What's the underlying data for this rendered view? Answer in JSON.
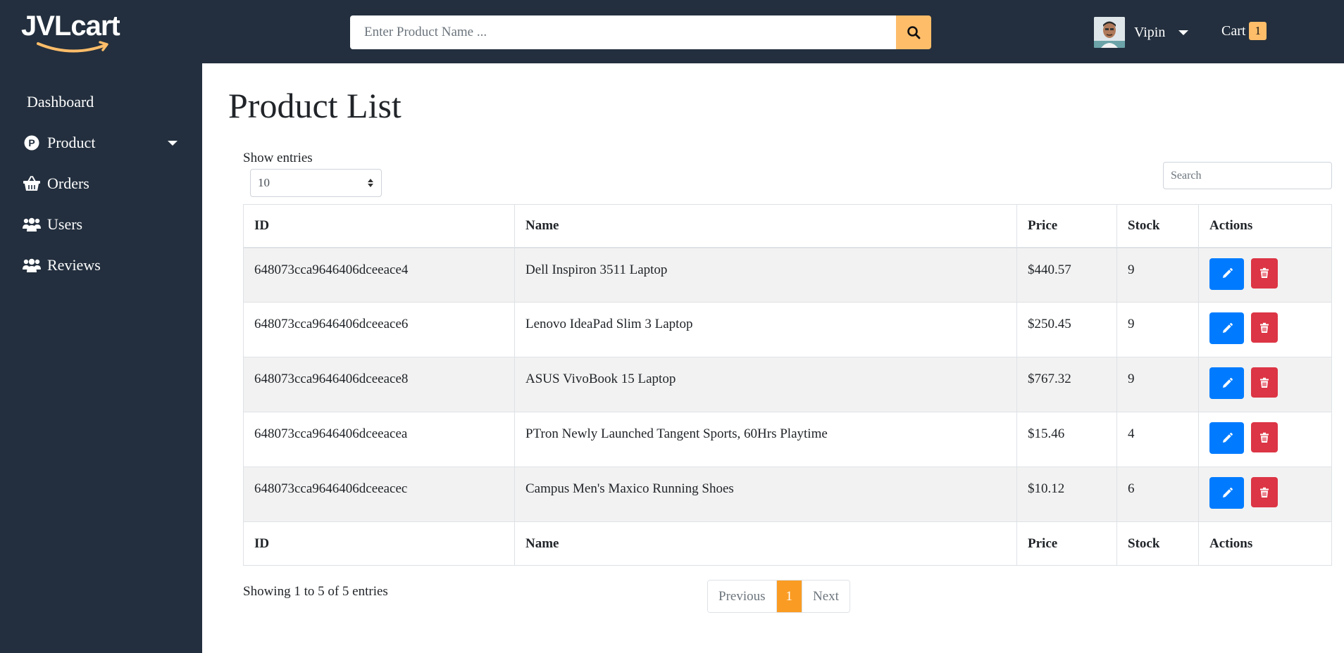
{
  "brand": {
    "name": "JVLcart",
    "smile_color": "#febd69"
  },
  "colors": {
    "header_bg": "#232f3e",
    "accent": "#febd69",
    "edit": "#007bff",
    "delete": "#dc3545",
    "active_page": "#fa9c23"
  },
  "search": {
    "placeholder": "Enter Product Name ..."
  },
  "user": {
    "name": "Vipin"
  },
  "cart": {
    "label": "Cart",
    "count": "1"
  },
  "sidebar": {
    "items": [
      {
        "label": "Dashboard",
        "icon": ""
      },
      {
        "label": "Product",
        "icon": "product-p-icon"
      },
      {
        "label": "Orders",
        "icon": "basket-icon"
      },
      {
        "label": "Users",
        "icon": "users-icon"
      },
      {
        "label": "Reviews",
        "icon": "users-icon"
      }
    ]
  },
  "main": {
    "title": "Product List",
    "show_entries_label": "Show entries",
    "entries_value": "10",
    "table_search_placeholder": "Search",
    "columns": [
      "ID",
      "Name",
      "Price",
      "Stock",
      "Actions"
    ],
    "rows": [
      {
        "id": "648073cca9646406dceeace4",
        "name": "Dell Inspiron 3511 Laptop",
        "price": "$440.57",
        "stock": "9"
      },
      {
        "id": "648073cca9646406dceeace6",
        "name": "Lenovo IdeaPad Slim 3 Laptop",
        "price": "$250.45",
        "stock": "9"
      },
      {
        "id": "648073cca9646406dceeace8",
        "name": "ASUS VivoBook 15 Laptop",
        "price": "$767.32",
        "stock": "9"
      },
      {
        "id": "648073cca9646406dceeacea",
        "name": "PTron Newly Launched Tangent Sports, 60Hrs Playtime",
        "price": "$15.46",
        "stock": "4"
      },
      {
        "id": "648073cca9646406dceeacec",
        "name": "Campus Men's Maxico Running Shoes",
        "price": "$10.12",
        "stock": "6"
      }
    ],
    "showing_text": "Showing 1 to 5 of 5 entries",
    "pagination": {
      "previous": "Previous",
      "current": "1",
      "next": "Next"
    }
  }
}
